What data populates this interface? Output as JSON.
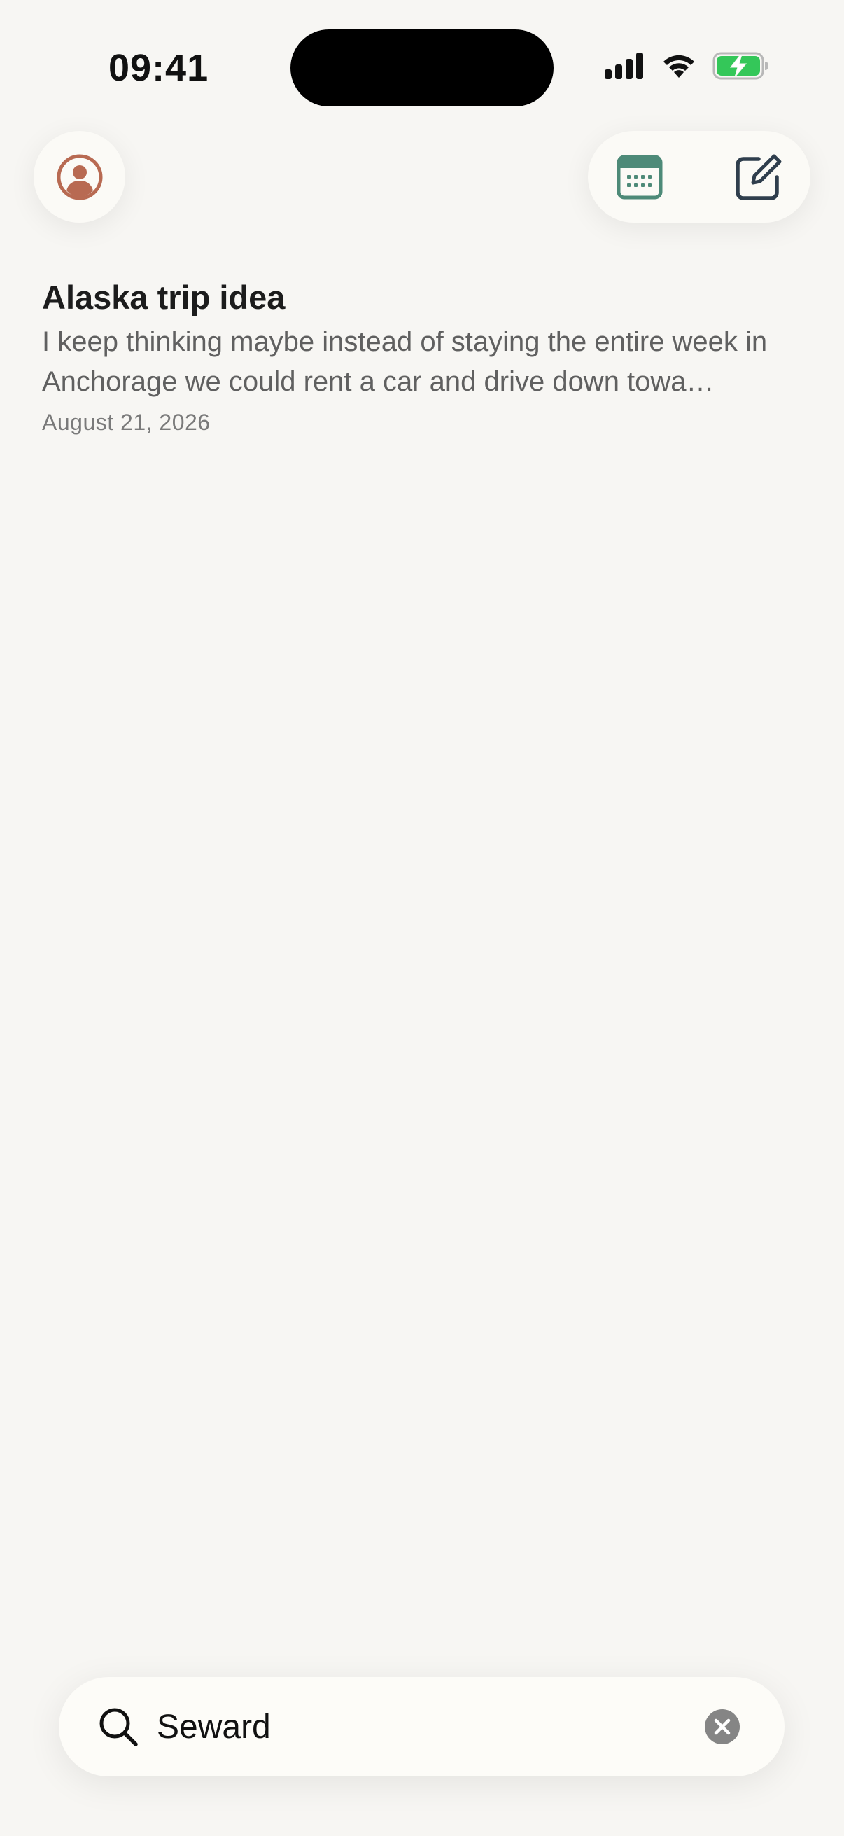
{
  "status_bar": {
    "time": "09:41",
    "icons": [
      "cellular-signal-icon",
      "wifi-icon",
      "battery-charging-icon"
    ]
  },
  "header": {
    "profile_icon": "person-icon",
    "calendar_icon": "calendar-icon",
    "compose_icon": "compose-icon"
  },
  "notes": [
    {
      "title": "Alaska trip idea",
      "preview": "I keep thinking maybe instead of staying the entire week in Anchorage we could rent a car and drive down towa…",
      "date": "August 21, 2026"
    }
  ],
  "search": {
    "value": "Seward",
    "icon": "search-icon",
    "clear_icon": "clear-icon"
  },
  "colors": {
    "background": "#f7f6f3",
    "profile_accent": "#b86a52",
    "calendar_accent": "#4d8a78",
    "compose_accent": "#2f3e4d",
    "battery_green": "#34c759"
  }
}
